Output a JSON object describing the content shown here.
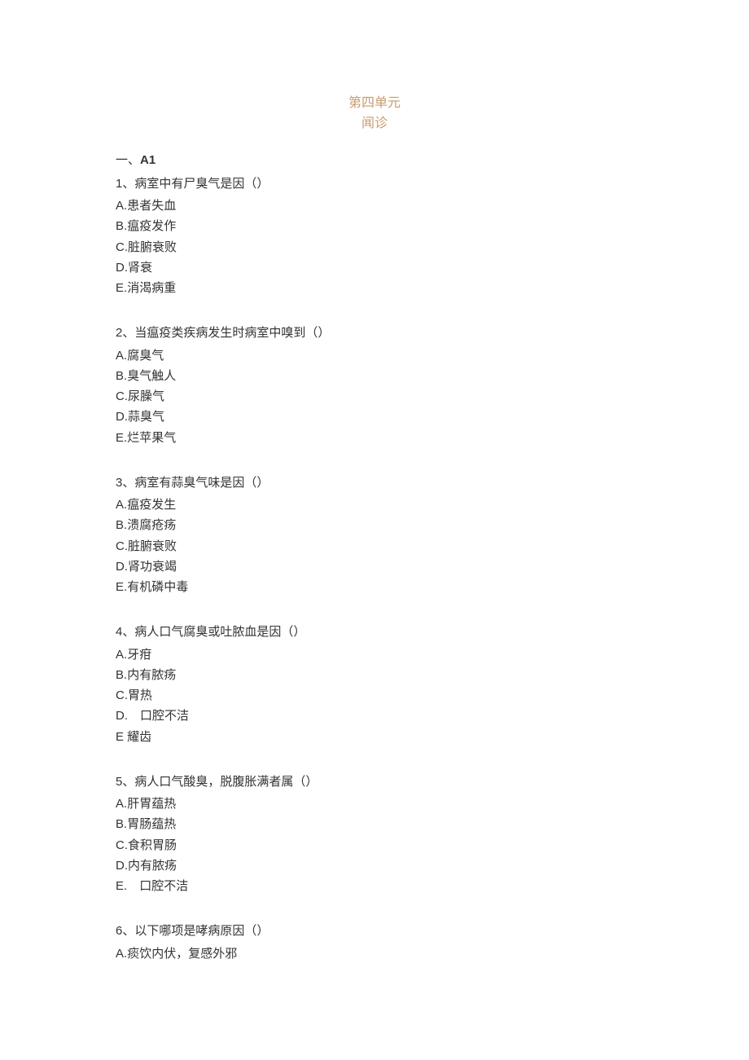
{
  "header": {
    "unit_title": "第四单元",
    "unit_subtitle": "闻诊"
  },
  "section": {
    "prefix": "一、",
    "type": "A1"
  },
  "questions": [
    {
      "stem": "1、病室中有尸臭气是因（）",
      "options": [
        {
          "label": "A.",
          "text": "患者失血"
        },
        {
          "label": "B.",
          "text": "瘟疫发作"
        },
        {
          "label": "C.",
          "text": "脏腑衰败"
        },
        {
          "label": "D.",
          "text": "肾衰"
        },
        {
          "label": "E.",
          "text": "消渴病重"
        }
      ]
    },
    {
      "stem": "2、当瘟疫类疾病发生时病室中嗅到（）",
      "options": [
        {
          "label": "A.",
          "text": "腐臭气"
        },
        {
          "label": "B.",
          "text": "臭气触人"
        },
        {
          "label": "C.",
          "text": "尿臊气"
        },
        {
          "label": "D.",
          "text": "蒜臭气"
        },
        {
          "label": "E.",
          "text": "烂苹果气"
        }
      ]
    },
    {
      "stem": "3、病室有蒜臭气味是因（）",
      "options": [
        {
          "label": "A.",
          "text": "瘟疫发生"
        },
        {
          "label": "B.",
          "text": "溃腐疮疡"
        },
        {
          "label": "C.",
          "text": "脏腑衰败"
        },
        {
          "label": "D.",
          "text": "肾功衰竭"
        },
        {
          "label": "E.",
          "text": "有机磷中毒"
        }
      ]
    },
    {
      "stem": "4、病人口气腐臭或吐脓血是因（）",
      "options": [
        {
          "label": "A.",
          "text": "牙疳"
        },
        {
          "label": "B.",
          "text": "内有脓疡"
        },
        {
          "label": "C.",
          "text": "胃热"
        },
        {
          "label": "D.",
          "text": "　口腔不洁"
        },
        {
          "label": "E",
          "text": " 耀齿"
        }
      ]
    },
    {
      "stem": "5、病人口气酸臭，脱腹胀满者属（）",
      "options": [
        {
          "label": "A.",
          "text": "肝胃蕴热"
        },
        {
          "label": "B.",
          "text": "胃肠蕴热"
        },
        {
          "label": "C.",
          "text": "食积胃肠"
        },
        {
          "label": "D.",
          "text": "内有脓疡"
        },
        {
          "label": "E.",
          "text": "　口腔不洁"
        }
      ]
    },
    {
      "stem": "6、以下哪项是哮病原因（）",
      "options": [
        {
          "label": "A.",
          "text": "痰饮内伏，复感外邪"
        }
      ]
    }
  ]
}
